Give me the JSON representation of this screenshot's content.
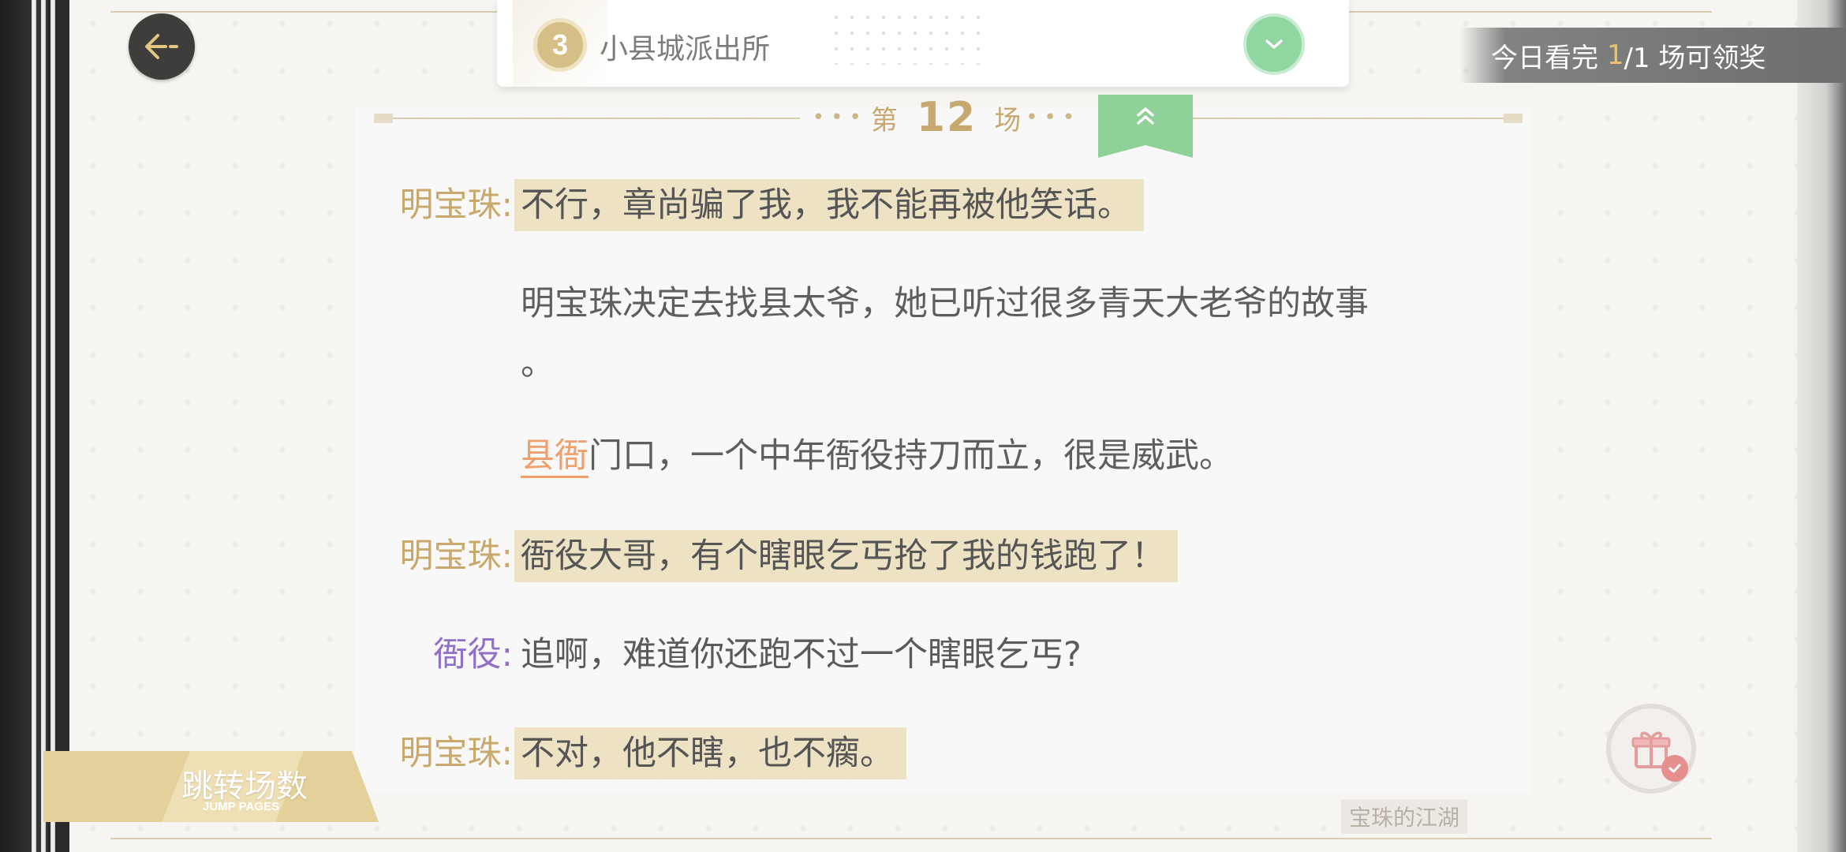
{
  "nav": {
    "back_icon": "arrow-left-icon"
  },
  "chapter": {
    "number": "3",
    "title": "小县城派出所",
    "check_icon": "chevron-down-icon"
  },
  "reward": {
    "prefix": "今日看完 ",
    "current": "1",
    "rest": "/1 场可领奖"
  },
  "scene": {
    "prefix": "第",
    "number": "12",
    "suffix": "场",
    "toggle_icon": "double-chevron-up-icon"
  },
  "lines": [
    {
      "speaker": "明宝珠:",
      "text": "不行，章尚骗了我，我不能再被他笑话。"
    },
    {
      "narration_1": "明宝珠决定去找县太爷，她已听过很多青天大老爷的故事",
      "narration_2": "。"
    },
    {
      "place": "县衙",
      "rest": "门口，一个中年衙役持刀而立，很是威武。"
    },
    {
      "speaker": "明宝珠:",
      "text": "衙役大哥，有个瞎眼乞丐抢了我的钱跑了！"
    },
    {
      "speaker": "衙役:",
      "text": "追啊，难道你还跑不过一个瞎眼乞丐?"
    },
    {
      "speaker": "明宝珠:",
      "text": "不对，他不瞎，也不瘸。"
    }
  ],
  "jump": {
    "label": "跳转场数",
    "sub_label": "JUMP PAGES"
  },
  "gift": {
    "icon": "gift-icon",
    "badge_icon": "check-icon"
  },
  "book_title": "宝珠的江湖",
  "colors": {
    "accent_gold": "#c9a86c",
    "highlight_bg": "#ede2c4",
    "speaker_purple": "#9070c8",
    "link_orange": "#f0a06a",
    "green": "#8ed29a"
  }
}
